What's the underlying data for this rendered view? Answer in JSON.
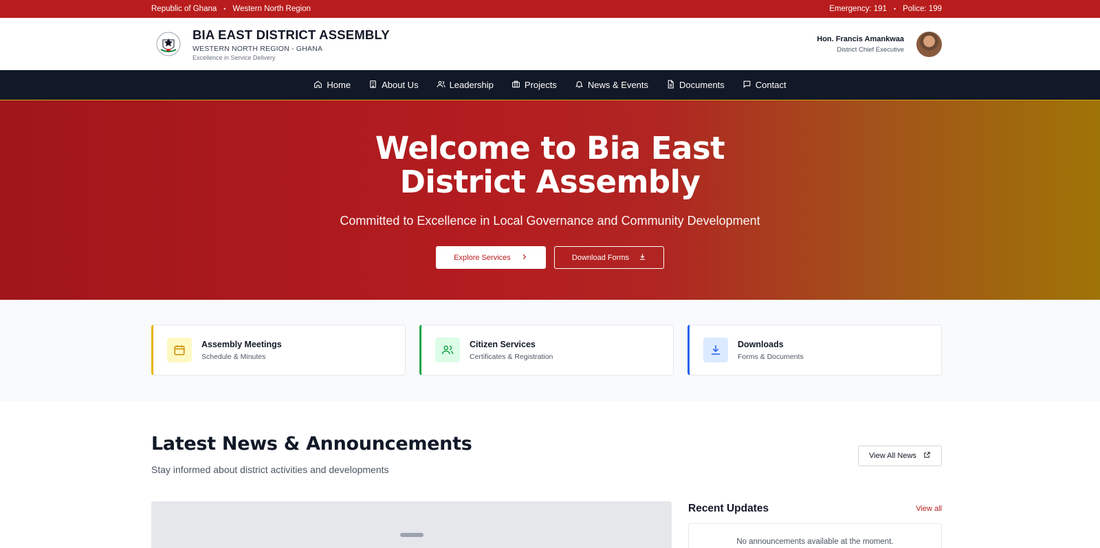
{
  "topbar": {
    "country": "Republic of Ghana",
    "region": "Western North Region",
    "emergency": "Emergency: 191",
    "police": "Police: 199"
  },
  "header": {
    "title": "BIA EAST DISTRICT ASSEMBLY",
    "subtitle": "WESTERN NORTH REGION - GHANA",
    "tagline": "Excellence in Service Delivery",
    "official_name": "Hon. Francis Amankwaa",
    "official_role": "District Chief Executive"
  },
  "nav": {
    "items": [
      {
        "label": "Home",
        "icon": "home-icon"
      },
      {
        "label": "About Us",
        "icon": "building-icon"
      },
      {
        "label": "Leadership",
        "icon": "users-icon"
      },
      {
        "label": "Projects",
        "icon": "briefcase-icon"
      },
      {
        "label": "News & Events",
        "icon": "bell-icon"
      },
      {
        "label": "Documents",
        "icon": "document-icon"
      },
      {
        "label": "Contact",
        "icon": "message-icon"
      }
    ]
  },
  "hero": {
    "title": "Welcome to Bia East District Assembly",
    "subtitle": "Committed to Excellence in Local Governance and Community Development",
    "primary_button": "Explore Services",
    "secondary_button": "Download Forms"
  },
  "quick_links": [
    {
      "title": "Assembly Meetings",
      "subtitle": "Schedule & Minutes",
      "icon": "calendar-icon",
      "accent": "#eab308"
    },
    {
      "title": "Citizen Services",
      "subtitle": "Certificates & Registration",
      "icon": "users-icon",
      "accent": "#16a34a"
    },
    {
      "title": "Downloads",
      "subtitle": "Forms & Documents",
      "icon": "download-icon",
      "accent": "#2563eb"
    }
  ],
  "news": {
    "title": "Latest News & Announcements",
    "lead": "Stay informed about district activities and developments",
    "view_all_button": "View All News",
    "updates_title": "Recent Updates",
    "updates_link": "View all",
    "empty_message": "No announcements available at the moment."
  },
  "colors": {
    "primary_red": "#b91c1c",
    "nav_dark": "#111827",
    "gold": "#9f7406"
  }
}
